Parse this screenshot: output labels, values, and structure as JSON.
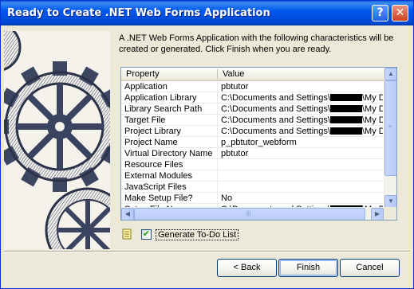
{
  "window": {
    "title": "Ready to Create .NET Web Forms Application",
    "help_label": "?",
    "close_label": "✕"
  },
  "description": "A .NET Web Forms Application with the following characteristics will be created or generated.  Click Finish when you are ready.",
  "grid": {
    "headers": [
      "Property",
      "Value"
    ],
    "rows": [
      {
        "property": "Application",
        "value_prefix": "pbtutor",
        "redacted": false,
        "value_suffix": ""
      },
      {
        "property": "Application Library",
        "value_prefix": "C:\\Documents and Settings\\",
        "redacted": true,
        "value_suffix": "\\My Do"
      },
      {
        "property": "Library Search Path",
        "value_prefix": "C:\\Documents and Settings\\",
        "redacted": true,
        "value_suffix": "\\My Do"
      },
      {
        "property": "Target File",
        "value_prefix": "C:\\Documents and Settings\\",
        "redacted": true,
        "value_suffix": "\\My Do"
      },
      {
        "property": "Project Library",
        "value_prefix": "C:\\Documents and Settings\\",
        "redacted": true,
        "value_suffix": "\\My Do"
      },
      {
        "property": "Project Name",
        "value_prefix": "p_pbtutor_webform",
        "redacted": false,
        "value_suffix": ""
      },
      {
        "property": "Virtual Directory Name",
        "value_prefix": "pbtutor",
        "redacted": false,
        "value_suffix": ""
      },
      {
        "property": "Resource Files",
        "value_prefix": "",
        "redacted": false,
        "value_suffix": ""
      },
      {
        "property": "External Modules",
        "value_prefix": "",
        "redacted": false,
        "value_suffix": ""
      },
      {
        "property": "JavaScript Files",
        "value_prefix": "",
        "redacted": false,
        "value_suffix": ""
      },
      {
        "property": "Make Setup File?",
        "value_prefix": "No",
        "redacted": false,
        "value_suffix": ""
      },
      {
        "property": "Setup File Name",
        "value_prefix": "C:\\Documents and Settings\\",
        "redacted": true,
        "value_suffix": "\\My Do"
      }
    ]
  },
  "todo": {
    "label": "Generate To-Do List",
    "checked": true,
    "check_glyph": "✔"
  },
  "buttons": {
    "back": "< Back",
    "finish": "Finish",
    "cancel": "Cancel"
  },
  "colors": {
    "titlebar": "#0058ee",
    "dialog_bg": "#ece9d8",
    "checkmark": "#21a121"
  }
}
